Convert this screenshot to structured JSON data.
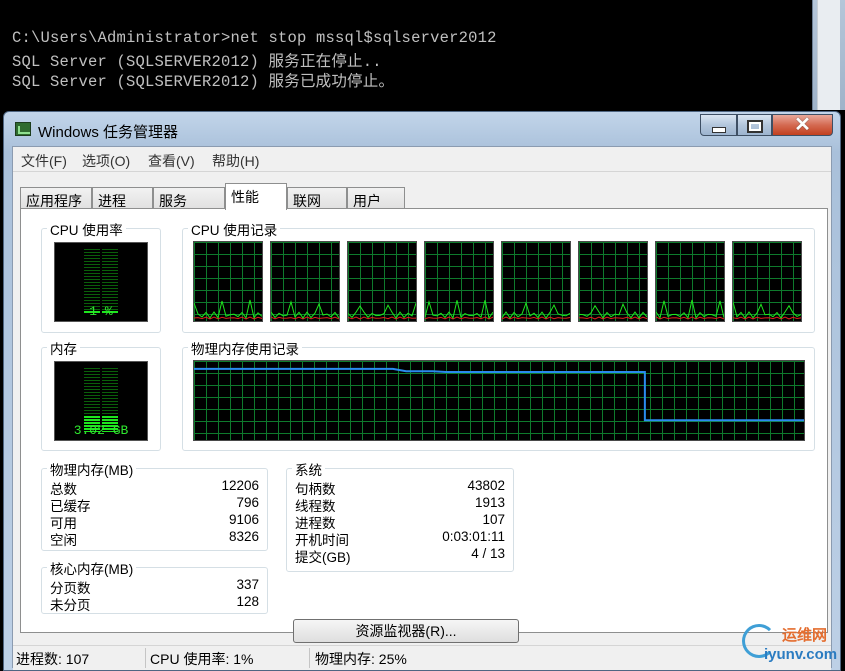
{
  "console": {
    "lines": [
      "C:\\Users\\Administrator>net stop mssql$sqlserver2012",
      "SQL Server (SQLSERVER2012) 服务正在停止..",
      "SQL Server (SQLSERVER2012) 服务已成功停止。"
    ]
  },
  "window": {
    "title": "Windows 任务管理器",
    "min_icon": "minimize-icon",
    "max_icon": "maximize-icon",
    "close_glyph": "✕"
  },
  "menu": [
    "文件(F)",
    "选项(O)",
    "查看(V)",
    "帮助(H)"
  ],
  "tabs": [
    "应用程序",
    "进程",
    "服务",
    "性能",
    "联网",
    "用户"
  ],
  "active_tab": "性能",
  "performance": {
    "cpu_usage_label": "CPU 使用率",
    "cpu_usage_value": "1 %",
    "cpu_usage_fraction": 0.01,
    "cpu_history_label": "CPU 使用记录",
    "cpu_core_count": 8,
    "memory_label": "内存",
    "memory_value": "3.02 GB",
    "memory_fraction": 0.25,
    "memory_history_label": "物理内存使用记录",
    "memory_history": [
      0.9,
      0.9,
      0.9,
      0.9,
      0.9,
      0.9,
      0.9,
      0.9,
      0.9,
      0.9,
      0.9,
      0.9,
      0.9,
      0.9,
      0.9,
      0.9,
      0.87,
      0.87,
      0.87,
      0.86,
      0.86,
      0.86,
      0.86,
      0.86,
      0.86,
      0.86,
      0.86,
      0.86,
      0.86,
      0.86,
      0.86,
      0.86,
      0.86,
      0.86,
      0.25,
      0.25,
      0.25,
      0.25,
      0.25,
      0.25,
      0.25,
      0.25,
      0.25,
      0.25,
      0.25,
      0.25,
      0.25
    ]
  },
  "physical_memory": {
    "label": "物理内存(MB)",
    "rows": [
      {
        "name": "总数",
        "value": "12206"
      },
      {
        "name": "已缓存",
        "value": "796"
      },
      {
        "name": "可用",
        "value": "9106"
      },
      {
        "name": "空闲",
        "value": "8326"
      }
    ]
  },
  "kernel_memory": {
    "label": "核心内存(MB)",
    "rows": [
      {
        "name": "分页数",
        "value": "337"
      },
      {
        "name": "未分页",
        "value": "128"
      }
    ]
  },
  "system": {
    "label": "系统",
    "rows": [
      {
        "name": "句柄数",
        "value": "43802"
      },
      {
        "name": "线程数",
        "value": "1913"
      },
      {
        "name": "进程数",
        "value": "107"
      },
      {
        "name": "开机时间",
        "value": "0:03:01:11"
      },
      {
        "name": "提交(GB)",
        "value": "4 / 13"
      }
    ]
  },
  "resmon_button": "资源监视器(R)...",
  "status": {
    "processes": "进程数: 107",
    "cpu": "CPU 使用率: 1%",
    "memory": "物理内存: 25%"
  },
  "watermark": {
    "line1": "运维网",
    "line2": "iyunv.com"
  },
  "colors": {
    "graph_line_cpu": "#1ee61e",
    "graph_line_kernel": "#e02020",
    "graph_line_memory": "#2a8bef",
    "graph_grid": "#0e7a2c"
  }
}
